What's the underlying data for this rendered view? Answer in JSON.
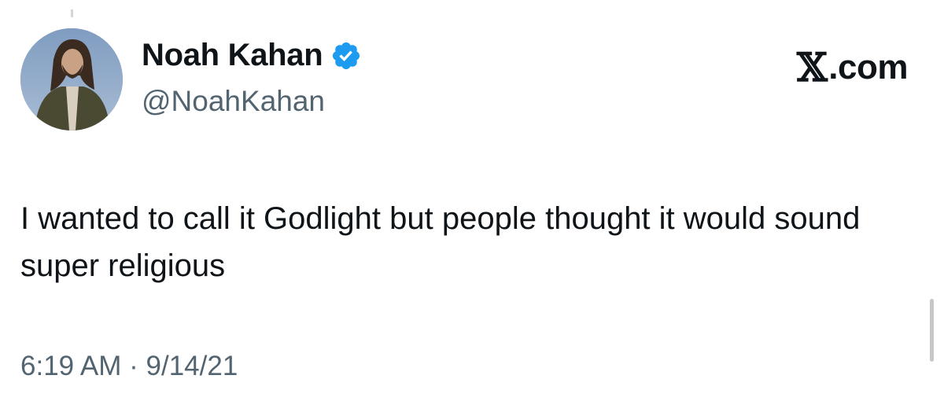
{
  "author": {
    "display_name": "Noah Kahan",
    "handle": "@NoahKahan",
    "verified": true
  },
  "brand": {
    "label": "X.com",
    "x_glyph": "𝕏",
    "suffix": ".com"
  },
  "tweet": {
    "text": "I wanted to call it Godlight but people thought it would sound super religious",
    "timestamp": "6:19 AM · 9/14/21"
  },
  "icons": {
    "verified": "verified-badge-icon",
    "avatar": "profile-avatar"
  },
  "colors": {
    "text_primary": "#0f1419",
    "text_secondary": "#536471",
    "verified_blue": "#1d9bf0",
    "background": "#ffffff"
  }
}
